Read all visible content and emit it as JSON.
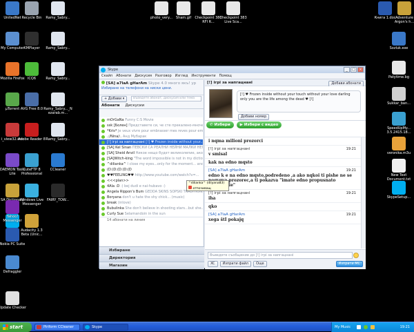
{
  "desktop": {
    "icons_left": [
      {
        "label": "UnitedNet",
        "color": "#3a78c8"
      },
      {
        "label": "Recycle Bin",
        "color": "#9aa4b0"
      },
      {
        "label": "Ramy_Sabry...",
        "color": "#e0e6ef"
      },
      {
        "label": "My Computer",
        "color": "#5b8fd0"
      },
      {
        "label": "KMPlayer",
        "color": "#2f2f2f"
      },
      {
        "label": "Ramy_Sabry...",
        "color": "#e0e6ef"
      },
      {
        "label": "Mozilla Firefox",
        "color": "#e8732a"
      },
      {
        "label": "ICQ6",
        "color": "#4dbb3a"
      },
      {
        "label": "Ramy_Sabry...",
        "color": "#e0e6ef"
      },
      {
        "label": "µTorrent",
        "color": "#59a84a"
      },
      {
        "label": "AVG Free 8.0",
        "color": "#4a6ea8"
      },
      {
        "label": "Ramy_Sabry..._Nezarab.m...",
        "color": "#e0e6ef"
      },
      {
        "label": "i_view32.exe",
        "color": "#c83a3a"
      },
      {
        "label": "Adobe Reader 8",
        "color": "#c81e1e"
      },
      {
        "label": "Ramy_Sabry...",
        "color": "#e0e6ef"
      },
      {
        "label": "DAEMON Tools Lite",
        "color": "#7a4ac8"
      },
      {
        "label": "CuteFTP 8 Professional",
        "color": "#3aa0d0"
      },
      {
        "label": "CCleaner",
        "color": "#2a7ad0"
      },
      {
        "label": "SA Dictionary",
        "color": "#c8a23a"
      },
      {
        "label": "Windows Live Messenger",
        "color": "#3ab0e0"
      },
      {
        "label": "FAIRY_TOW...",
        "color": "#2a2a2a"
      },
      {
        "label": "Skype",
        "color": "#00aff0"
      },
      {
        "label": "Audacity 1.3 Beta (Unic...",
        "color": "#d0a23a"
      },
      {
        "label": "Yahoo! Messenger",
        "color": "#7a2ab0"
      },
      {
        "label": "Nokia PC Suite",
        "color": "#2a5ab0"
      },
      {
        "label": "Defraggler",
        "color": "#4a8ad0"
      },
      {
        "label": "Update Checker",
        "color": "#e0e0e0"
      }
    ],
    "icons_top": [
      {
        "label": "photo_very...",
        "color": "#e8e8e8"
      },
      {
        "label": "Sham.gif",
        "color": "#e8e8e8"
      },
      {
        "label": "Checkpoint 383 RFI R...",
        "color": "#e8e8e8"
      },
      {
        "label": "Checkpoint 383 Live Sca...",
        "color": "#e8e8e8"
      }
    ],
    "icons_right": [
      {
        "label": "Книга 1.doc",
        "color": "#2a5ab0"
      },
      {
        "label": "Adventure Argon's h...",
        "color": "#c8a23a"
      },
      {
        "label": "Sozluk.exe",
        "color": "#3a78c8"
      },
      {
        "label": "Patytime.bg",
        "color": "#e8e8e8"
      },
      {
        "label": "Sukkar_ban...",
        "color": "#d0d0d0"
      },
      {
        "label": "SpeedUpMy... 3.5.2415.18...",
        "color": "#3aa0d0"
      },
      {
        "label": "veronika.m3u",
        "color": "#e8a23a"
      },
      {
        "label": "New Text Document.txt",
        "color": "#f0f0f0"
      },
      {
        "label": "SkypeSetup...",
        "color": "#00aff0"
      }
    ]
  },
  "taskbar": {
    "start_label": "start",
    "tasks": [
      "Piriform CCleaner",
      "Skype"
    ],
    "tray_label": "My Music",
    "clock": "19:21"
  },
  "skype": {
    "title": "Skype",
    "menu": [
      "Скайп",
      "Абонати",
      "Дискусия",
      "Разговор",
      "Изглед",
      "Инструменти",
      "Помощ"
    ],
    "profile_name": "[SA]  a7laA gHarAm",
    "profile_mood": "Skype 4.0 много якъ! ур",
    "phone_link": "Избиране на телефони на ниски цени.",
    "add_label": "Добави",
    "search_placeholder": "Въведете абонат, дискусия или тема",
    "tabs": [
      "Абонати",
      "Дискусии"
    ],
    "contacts": [
      {
        "name": "mOrGaNa",
        "mood": "Funny C:S Movie",
        "sel": false
      },
      {
        "name": "ssk [Болен]",
        "mood": "Представете си, че сте прекалено-мноче...",
        "sel": false
      },
      {
        "name": "*Kris*",
        "mood": "Je veux vivre pour embrasser mes reves pour emb...",
        "sel": false
      },
      {
        "name": ".:/Ninа/:.",
        "mood": "Анд Мубарак",
        "sel": false
      },
      {
        "name": "[!] ігрі за напгацнані",
        "mood": "[!] ♥ Frozen inside without your...",
        "sel": true
      },
      {
        "name": "[SA] Kel Sinan",
        "mood": "ПЕВСКИ СА РЕАЛНИ НЕЙНИ МАЛКИ НЕГОВИ...",
        "sel": false
      },
      {
        "name": "[SA] Sheid Anvil",
        "mood": "Никое нещо будет великолепие, ако не...",
        "sel": false
      },
      {
        "name": "[SA]Witch-king",
        "mood": "\"The word impossible is not in my dictio...",
        "sel": false
      },
      {
        "name": "^dilianka^",
        "mood": "I close my eyes...only for the moment... and...",
        "sel": false
      },
      {
        "name": "(D:(D:(D:(D:(D",
        "mood": "",
        "sel": false
      },
      {
        "name": "♥♥FEELING♥♥",
        "mood": "http://www.youtube.com/watch?v=...",
        "sel": false
      },
      {
        "name": "<<<plan>>",
        "mood": "",
        "sel": false
      },
      {
        "name": "4Ala :D",
        "mood": ":) bej dudi e nai-hubavo :)",
        "sel": false
      },
      {
        "name": "Angela Rippon's Bum",
        "mood": "GEDDA SKINS SOPSKI TRADITION...",
        "sel": false
      },
      {
        "name": "Boryana",
        "mood": "don't u hate the shy chick... (music)",
        "sel": false
      },
      {
        "name": "break",
        "mood": "(inlove)",
        "sel": false
      },
      {
        "name": "Bubulinka",
        "mood": "She don't believe in shooting stars...but she...",
        "sel": false
      },
      {
        "name": "Curly Sue",
        "mood": "Selamandoin in the sun",
        "sel": false
      },
      {
        "name": "14 абонати на линия",
        "mood": "",
        "sel": false
      }
    ],
    "side_buttons": [
      "Избиране",
      "Директория",
      "Магазин"
    ],
    "chat_title": "[!] ігрі за напгацнані",
    "add_contacts_btn": "Добави абонати",
    "bubble_text": "[!] ♥ Frozen inside without your touch without your love darling only you are the life among the dead ♥ [!]",
    "add_number_btn": "Добави номер",
    "call_btn": "Избери",
    "video_btn": "Избери с видео",
    "messages": [
      {
        "who": "",
        "text": "i nqma milioni prozorci",
        "time": ""
      },
      {
        "who": "[!] ігрі за напгацнані",
        "text": "v smisal",
        "time": "19:21"
      },
      {
        "who": "",
        "text": "kak na edno mqsto",
        "time": ""
      },
      {
        "who": "[SA]  a7laA gHarAm",
        "text": "edno k e na edno mqsto,podredeno ,a ako nqkoi ti pishe ne se poqvqva prozorec,a ti pokazva \"imate edno propusnato saobštenie\"",
        "time": "19:21"
      },
      {
        "who": "[!] ігрі за напгацнані",
        "text": "iha",
        "time": "19:21"
      },
      {
        "who": "",
        "text": "qko",
        "time": ""
      },
      {
        "who": "[SA]  a7laA gHarAm",
        "text": "xega štI pokajq",
        "time": "19:21"
      }
    ],
    "input_placeholder": "Въведете съобщение до [!] ігрі за напгацнані",
    "bottom_btns": [
      "XC",
      "Изпрати файл",
      "Още"
    ],
    "send_btn": "Изпрати МС",
    "tooltip_title": "^dilianka^ (dilyana83)",
    "tooltip_status": "отпочиващ"
  }
}
